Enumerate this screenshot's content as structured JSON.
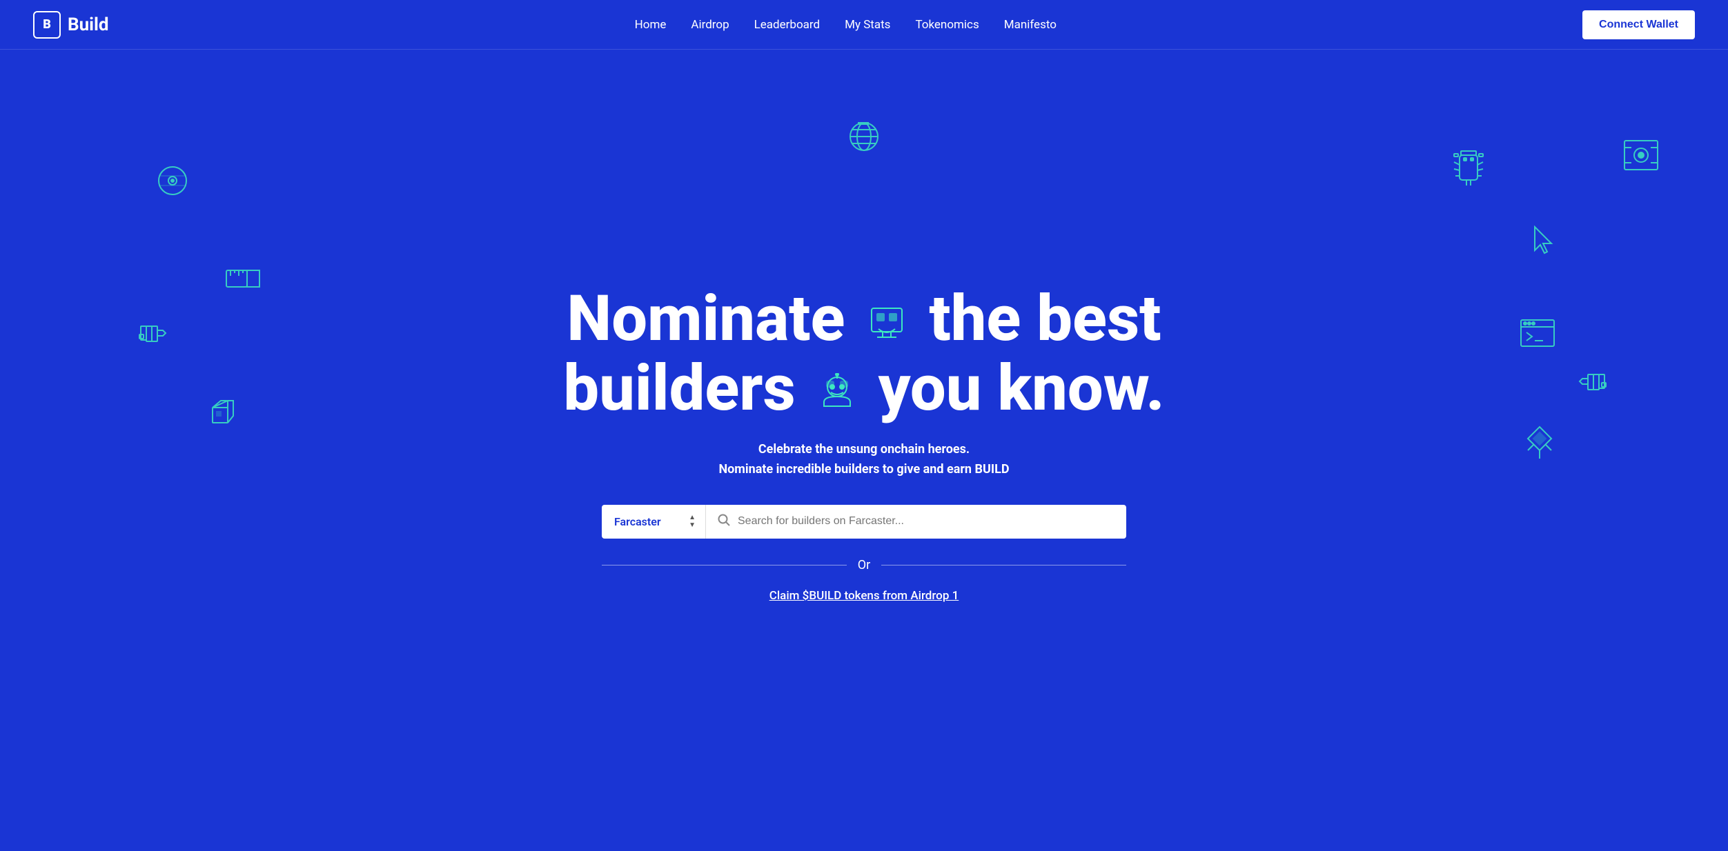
{
  "nav": {
    "logo_icon": "B",
    "logo_text": "Build",
    "links": [
      {
        "label": "Home",
        "href": "#"
      },
      {
        "label": "Airdrop",
        "href": "#"
      },
      {
        "label": "Leaderboard",
        "href": "#"
      },
      {
        "label": "My Stats",
        "href": "#"
      },
      {
        "label": "Tokenomics",
        "href": "#"
      },
      {
        "label": "Manifesto",
        "href": "#"
      }
    ],
    "connect_wallet": "Connect Wallet"
  },
  "hero": {
    "title_line1": "Nominate",
    "title_line2": "the best",
    "title_line3": "builders",
    "title_line4": "you know.",
    "subtitle_line1": "Celebrate the unsung onchain heroes.",
    "subtitle_line2": "Nominate incredible builders to give and earn BUILD",
    "platform": "Farcaster",
    "search_placeholder": "Search for builders on Farcaster...",
    "or_text": "Or",
    "claim_link": "Claim $BUILD tokens from Airdrop 1"
  },
  "colors": {
    "bg": "#1a35d4",
    "accent": "#3de8c0",
    "white": "#ffffff",
    "btn_bg": "#ffffff",
    "btn_text": "#1a35d4"
  },
  "icons": {
    "globe": "🌐",
    "search": "🔍",
    "chevron_up": "▲",
    "chevron_down": "▼"
  }
}
